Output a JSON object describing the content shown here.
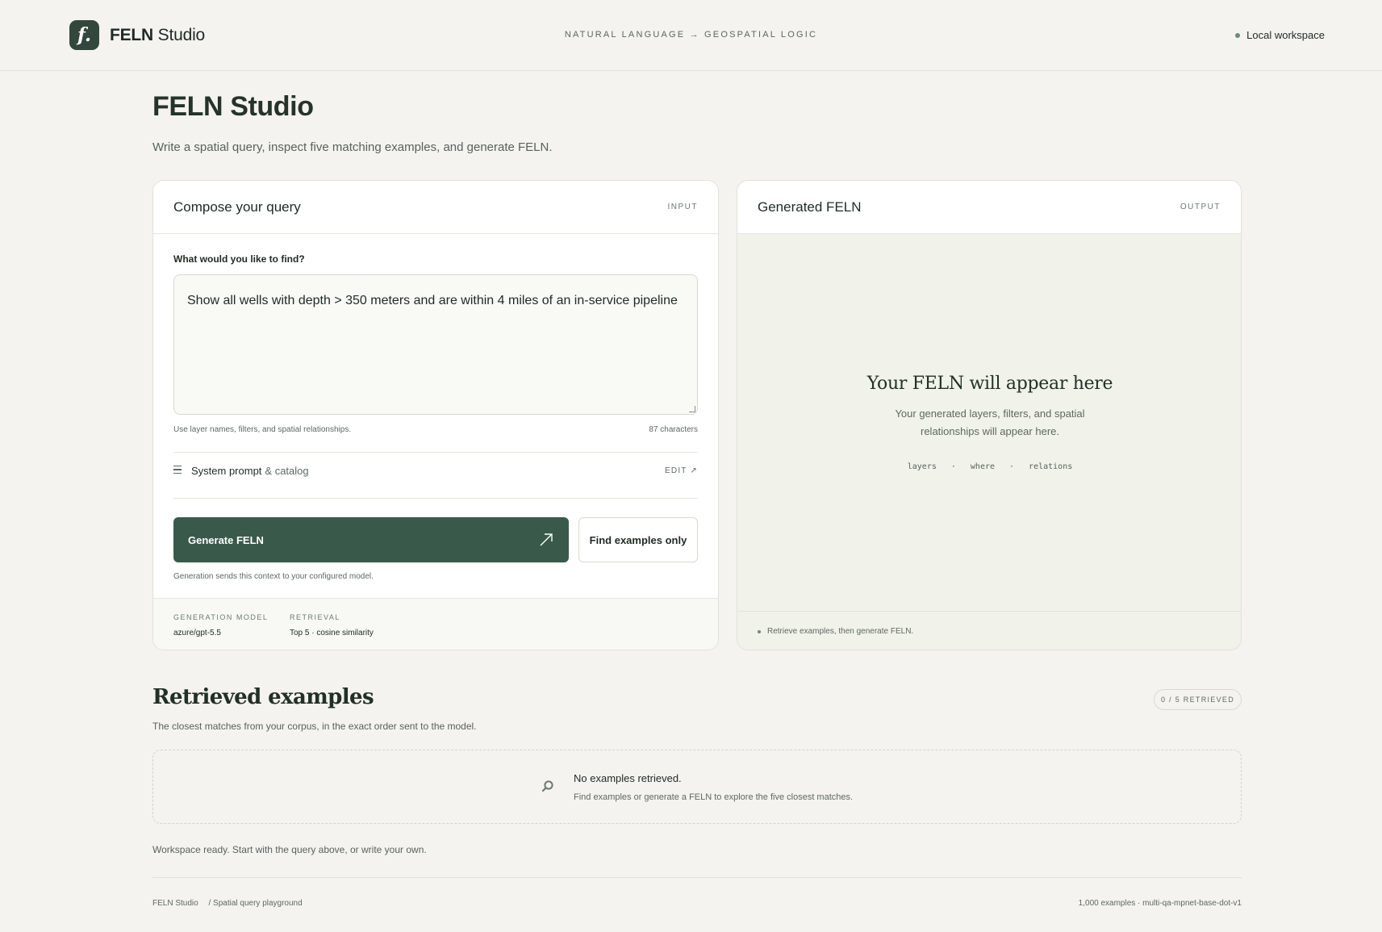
{
  "header": {
    "brand_mark": "f.",
    "brand_bold": "FELN",
    "brand_rest": "Studio",
    "tagline": "NATURAL LANGUAGE → GEOSPATIAL LOGIC",
    "workspace": "Local workspace"
  },
  "intro": {
    "title": "FELN Studio",
    "subtitle": "Write a spatial query, inspect five matching examples, and generate FELN."
  },
  "input_card": {
    "title": "Compose your query",
    "tag": "INPUT",
    "field_label": "What would you like to find?",
    "query_value": "Show all wells with depth > 350 meters and are within 4 miles of an in-service pipeline",
    "hint": "Use layer names, filters, and spatial relationships.",
    "char_count": "87 characters",
    "system_prompt_label": "System prompt",
    "system_prompt_suffix": "& catalog",
    "edit_label": "EDIT ↗",
    "generate_label": "Generate FELN",
    "find_label": "Find examples only",
    "generation_note": "Generation sends this context to your configured model.",
    "meta": {
      "model_label": "GENERATION MODEL",
      "model_value": "azure/gpt-5.5",
      "retrieval_label": "RETRIEVAL",
      "retrieval_value": "Top 5 · cosine similarity"
    }
  },
  "output_card": {
    "title": "Generated FELN",
    "tag": "OUTPUT",
    "placeholder_title": "Your FELN will appear here",
    "placeholder_desc": "Your generated layers, filters, and spatial relationships will appear here.",
    "tokens": [
      "layers",
      "·",
      "where",
      "·",
      "relations"
    ],
    "footer": "Retrieve examples, then generate FELN."
  },
  "retrieved": {
    "title": "Retrieved examples",
    "subtitle": "The closest matches from your corpus, in the exact order sent to the model.",
    "badge": "0 / 5 RETRIEVED",
    "empty_title": "No examples retrieved.",
    "empty_desc": "Find examples or generate a FELN to explore the five closest matches."
  },
  "status": "Workspace ready. Start with the query above, or write your own.",
  "footer": {
    "left_name": "FELN Studio",
    "left_desc": "/ Spatial query playground",
    "right": "1,000 examples · multi-qa-mpnet-base-dot-v1"
  },
  "colors": {
    "accent": "#395a4b",
    "background": "#f4f3ef",
    "status_dot": "#6d8a72"
  },
  "icons": {
    "logo": "feln-logo-icon",
    "menu": "menu-lines-icon",
    "arrow": "arrow-up-right-icon",
    "search": "search-icon"
  }
}
